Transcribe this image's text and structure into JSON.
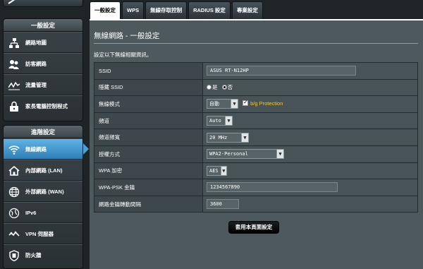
{
  "sidebar": {
    "general_header": "一般設定",
    "general_items": [
      {
        "label": "網路地圖",
        "icon": "network-map-icon"
      },
      {
        "label": "訪客網路",
        "icon": "guest-network-icon"
      },
      {
        "label": "流量管理",
        "icon": "traffic-manager-icon"
      },
      {
        "label": "家長電腦控制程式",
        "icon": "parental-control-icon"
      }
    ],
    "advanced_header": "進階設定",
    "advanced_items": [
      {
        "label": "無線網路",
        "icon": "wireless-icon"
      },
      {
        "label": "內部網路 (LAN)",
        "icon": "home-lan-icon"
      },
      {
        "label": "外部網路 (WAN)",
        "icon": "globe-wan-icon"
      },
      {
        "label": "IPv6",
        "icon": "ipv6-globe-icon"
      },
      {
        "label": "VPN 伺服器",
        "icon": "vpn-icon"
      },
      {
        "label": "防火牆",
        "icon": "firewall-shield-icon"
      }
    ]
  },
  "tabs": [
    "一般設定",
    "WPS",
    "無線存取控制",
    "RADIUS 設定",
    "專業設定"
  ],
  "main": {
    "title": "無線網路 - 一般設定",
    "description": "設定以下無線相關資訊。",
    "rows": {
      "ssid": {
        "label": "SSID",
        "value": "ASUS RT-N12HP"
      },
      "hide_ssid": {
        "label": "隱藏 SSID",
        "opt_yes": "是",
        "opt_no": "否",
        "selected": "否"
      },
      "wireless_mode": {
        "label": "無線模式",
        "value": "自動",
        "protection": "b/g Protection"
      },
      "channel": {
        "label": "頻道",
        "value": "Auto"
      },
      "bandwidth": {
        "label": "頻道頻寬",
        "value": "20 MHz"
      },
      "auth": {
        "label": "授權方式",
        "value": "WPA2-Personal"
      },
      "wpa_enc": {
        "label": "WPA 加密",
        "value": "AES"
      },
      "psk": {
        "label": "WPA-PSK 金鑰",
        "value": "1234567890"
      },
      "key_rotation": {
        "label": "網路金鑰轉動間隔",
        "value": "3600"
      }
    },
    "apply_label": "套用本頁面設定"
  }
}
